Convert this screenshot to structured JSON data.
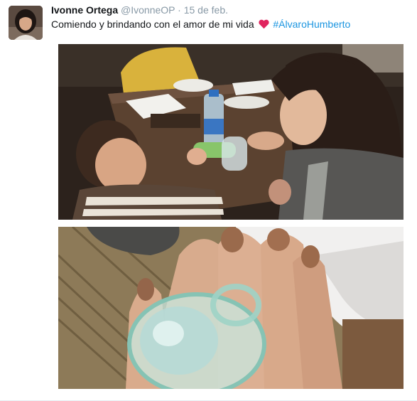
{
  "tweet": {
    "author_name": "Ivonne Ortega",
    "handle": "@IvonneOP",
    "separator": "·",
    "date": "15 de feb.",
    "text": "Comiendo y brindando con el amor de mi vida",
    "heart_icon": "red-heart-icon",
    "hashtag": "#ÁlvaroHumberto",
    "colors": {
      "name": "#14171a",
      "meta": "#8899a6",
      "hashtag": "#1b95e0",
      "heart": "#e0245e"
    }
  }
}
